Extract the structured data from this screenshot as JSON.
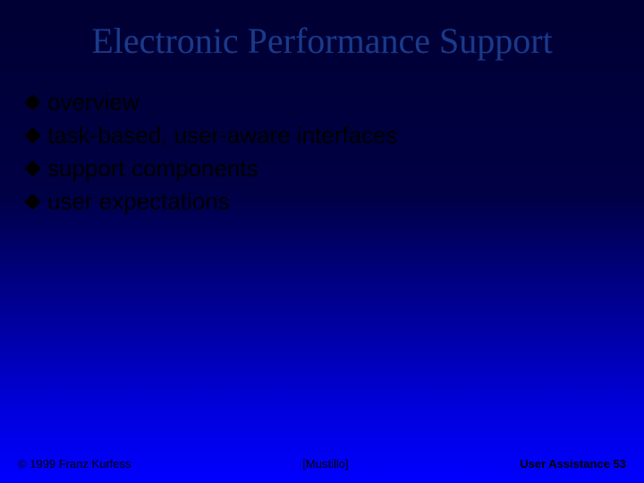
{
  "title": "Electronic Performance Support",
  "bullets": [
    "overview",
    "task-based, user-aware interfaces",
    "support components",
    "user expectations"
  ],
  "footer": {
    "left": "© 1999 Franz Kurfess",
    "center": "[Mustillo]",
    "right": "User Assistance 53"
  }
}
